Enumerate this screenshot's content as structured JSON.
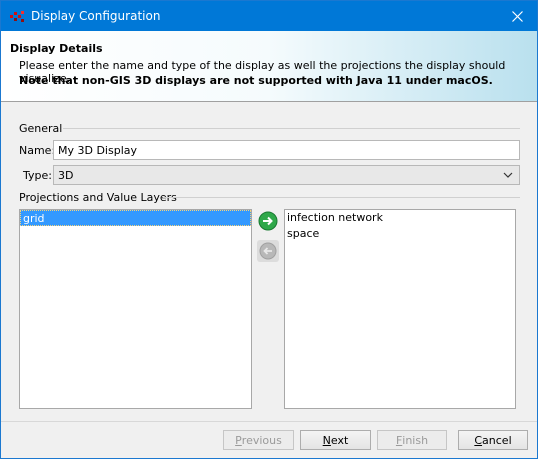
{
  "window": {
    "title": "Display Configuration",
    "accent_color": "#0078d7"
  },
  "header": {
    "title": "Display Details",
    "description": "Please enter the name and type of the display as well the projections the display should visualize.",
    "note": "Note that non-GIS 3D displays are not supported with Java 11 under macOS."
  },
  "general": {
    "section_label": "General",
    "name_label": "Name:",
    "name_value": "My 3D Display",
    "type_label": "Type:",
    "type_value": "3D"
  },
  "projections": {
    "section_label": "Projections and Value Layers",
    "left_items": [
      "grid"
    ],
    "right_items": [
      "infection network",
      "space"
    ]
  },
  "buttons": {
    "previous": {
      "first": "P",
      "rest": "revious"
    },
    "next": {
      "first": "N",
      "rest": "ext"
    },
    "finish": {
      "first": "F",
      "rest": "inish"
    },
    "cancel": {
      "first": "C",
      "rest": "ancel"
    }
  }
}
